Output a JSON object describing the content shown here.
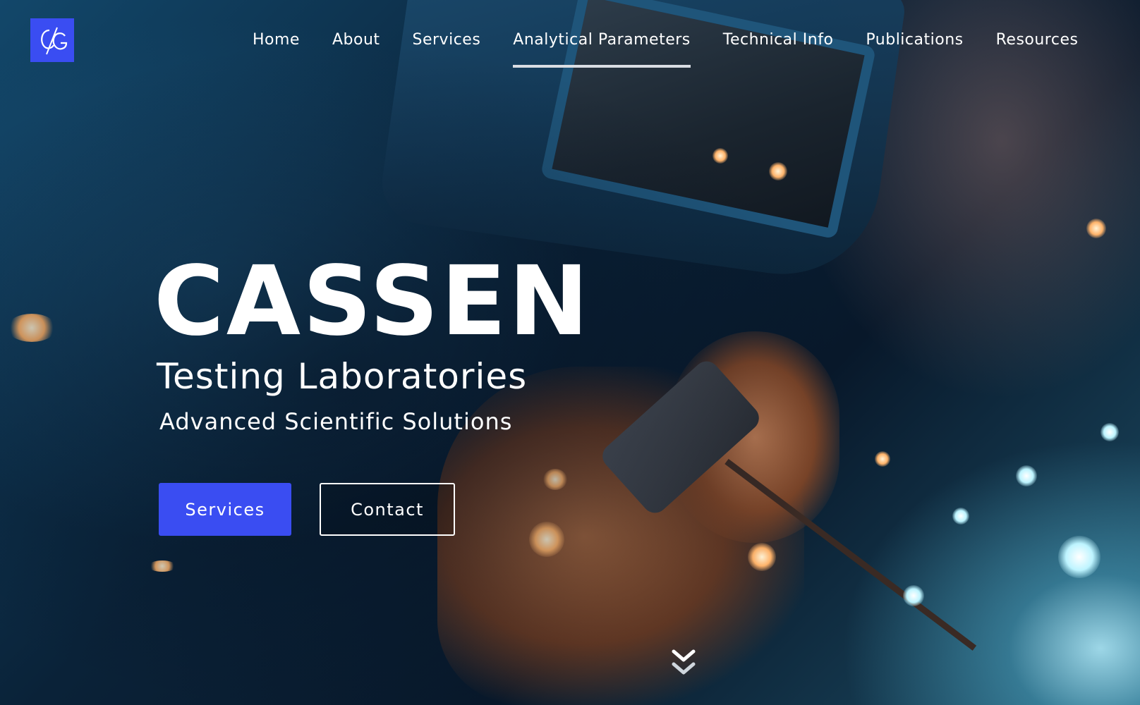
{
  "logo": {
    "text": "CG"
  },
  "nav": {
    "items": [
      {
        "label": "Home"
      },
      {
        "label": "About"
      },
      {
        "label": "Services"
      },
      {
        "label": "Analytical Parameters",
        "active": true
      },
      {
        "label": "Technical Info"
      },
      {
        "label": "Publications"
      },
      {
        "label": "Resources"
      }
    ]
  },
  "hero": {
    "title": "CASSEN",
    "subtitle": "Testing Laboratories",
    "tagline": "Advanced Scientific Solutions",
    "primary_button": "Services",
    "secondary_button": "Contact"
  },
  "icons": {
    "logo": "cg-monogram-logo",
    "scroll": "double-chevron-down-icon"
  },
  "colors": {
    "accent": "#3a4df2",
    "text": "#ffffff",
    "active_underline": "#d9dde3"
  }
}
